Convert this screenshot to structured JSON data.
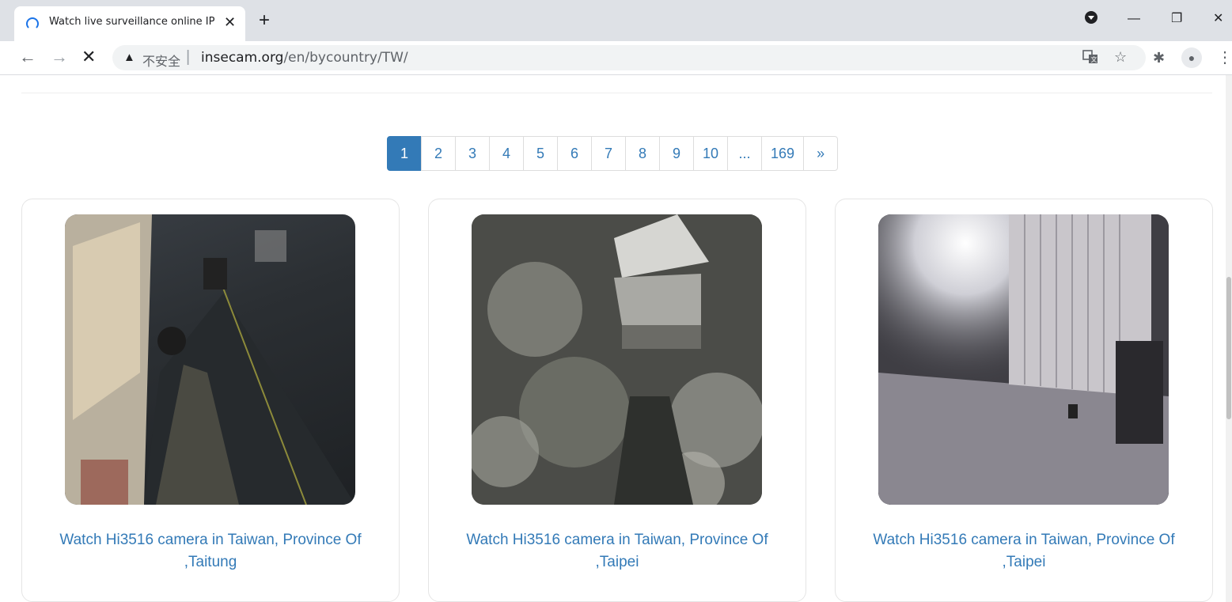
{
  "browser": {
    "tab_title": "Watch live surveillance online IP",
    "tab_close": "✕",
    "new_tab": "+",
    "window_controls": {
      "minimize": "—",
      "restore": "❐",
      "close": "✕"
    }
  },
  "toolbar": {
    "back": "←",
    "forward": "→",
    "stop": "✕",
    "security_warning": "▲",
    "not_secure_label": "不安全",
    "separator": "|",
    "url_host": "insecam.org",
    "url_path": "/en/bycountry/TW/",
    "translate_icon": "translate-icon",
    "bookmark_star": "☆",
    "extensions": "✱",
    "profile": "●",
    "menu": "⋮"
  },
  "pagination": {
    "pages": [
      "1",
      "2",
      "3",
      "4",
      "5",
      "6",
      "7",
      "8",
      "9",
      "10",
      "...",
      "169",
      "»"
    ],
    "active": "1"
  },
  "cameras": [
    {
      "caption_line1": "Watch Hi3516 camera in Taiwan, Province Of",
      "caption_line2": ",Taitung"
    },
    {
      "caption_line1": "Watch Hi3516 camera in Taiwan, Province Of",
      "caption_line2": ",Taipei"
    },
    {
      "caption_line1": "Watch Hi3516 camera in Taiwan, Province Of",
      "caption_line2": ",Taipei"
    }
  ],
  "colors": {
    "link": "#337ab7",
    "active_page_bg": "#337ab7",
    "tabstrip_bg": "#dee1e6"
  }
}
